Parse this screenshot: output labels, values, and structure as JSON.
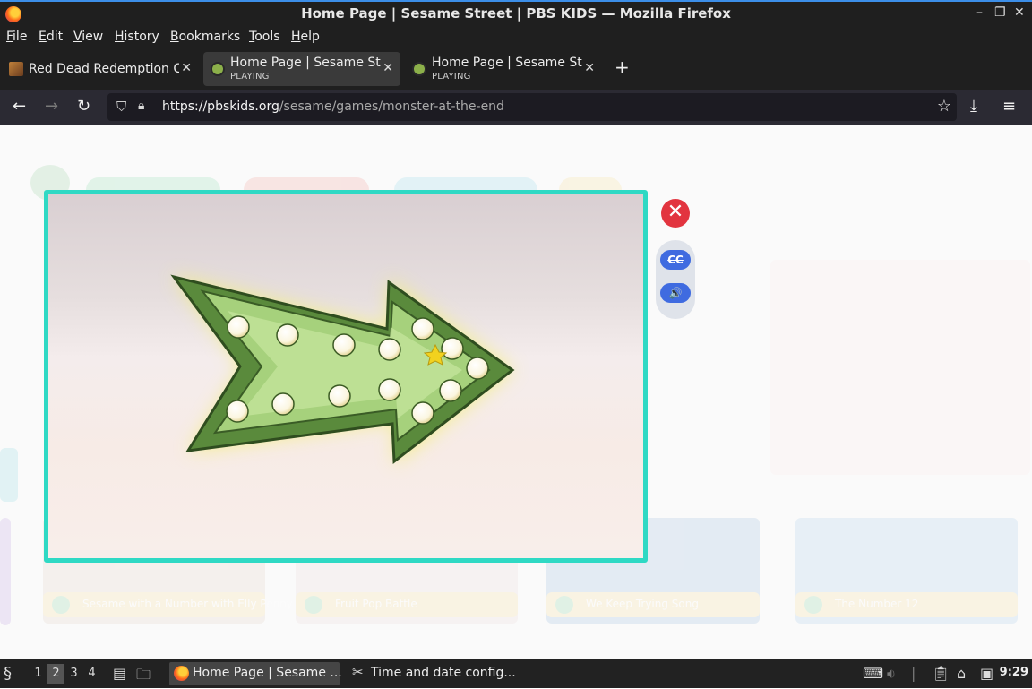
{
  "window": {
    "title": "Home Page | Sesame Street | PBS KIDS — Mozilla Firefox",
    "controls": [
      "–",
      "❐",
      "✕"
    ]
  },
  "menu": [
    "File",
    "Edit",
    "View",
    "History",
    "Bookmarks",
    "Tools",
    "Help"
  ],
  "tabs": [
    {
      "title": "Red Dead Redemption Cl",
      "sub": "",
      "close": "✕"
    },
    {
      "title": "Home Page | Sesame Stre",
      "sub": "PLAYING",
      "close": "✕"
    },
    {
      "title": "Home Page | Sesame Stre",
      "sub": "PLAYING",
      "close": "✕"
    }
  ],
  "new_tab": "+",
  "nav": {
    "back": "←",
    "forward": "→",
    "reload": "↻",
    "url_host": "https://pbskids.org",
    "url_path": "/sesame/games/monster-at-the-end",
    "bookmark": "☆",
    "download": "⤓",
    "menu": "≡"
  },
  "game": {
    "close": "✕",
    "cc": "CC",
    "volume": "🔊"
  },
  "background_captions": [
    "Sesame with a Number with Elly Penny",
    "Fruit Pop Battle",
    "We Keep Trying Song",
    "The Number 12"
  ],
  "taskbar": {
    "workspaces": [
      "1",
      "2",
      "3",
      "4"
    ],
    "active_workspace": 1,
    "tasks": [
      {
        "label": "Home Page | Sesame ...",
        "active": true
      },
      {
        "label": "Time and date config...",
        "active": false
      }
    ],
    "clock": "9:29"
  }
}
